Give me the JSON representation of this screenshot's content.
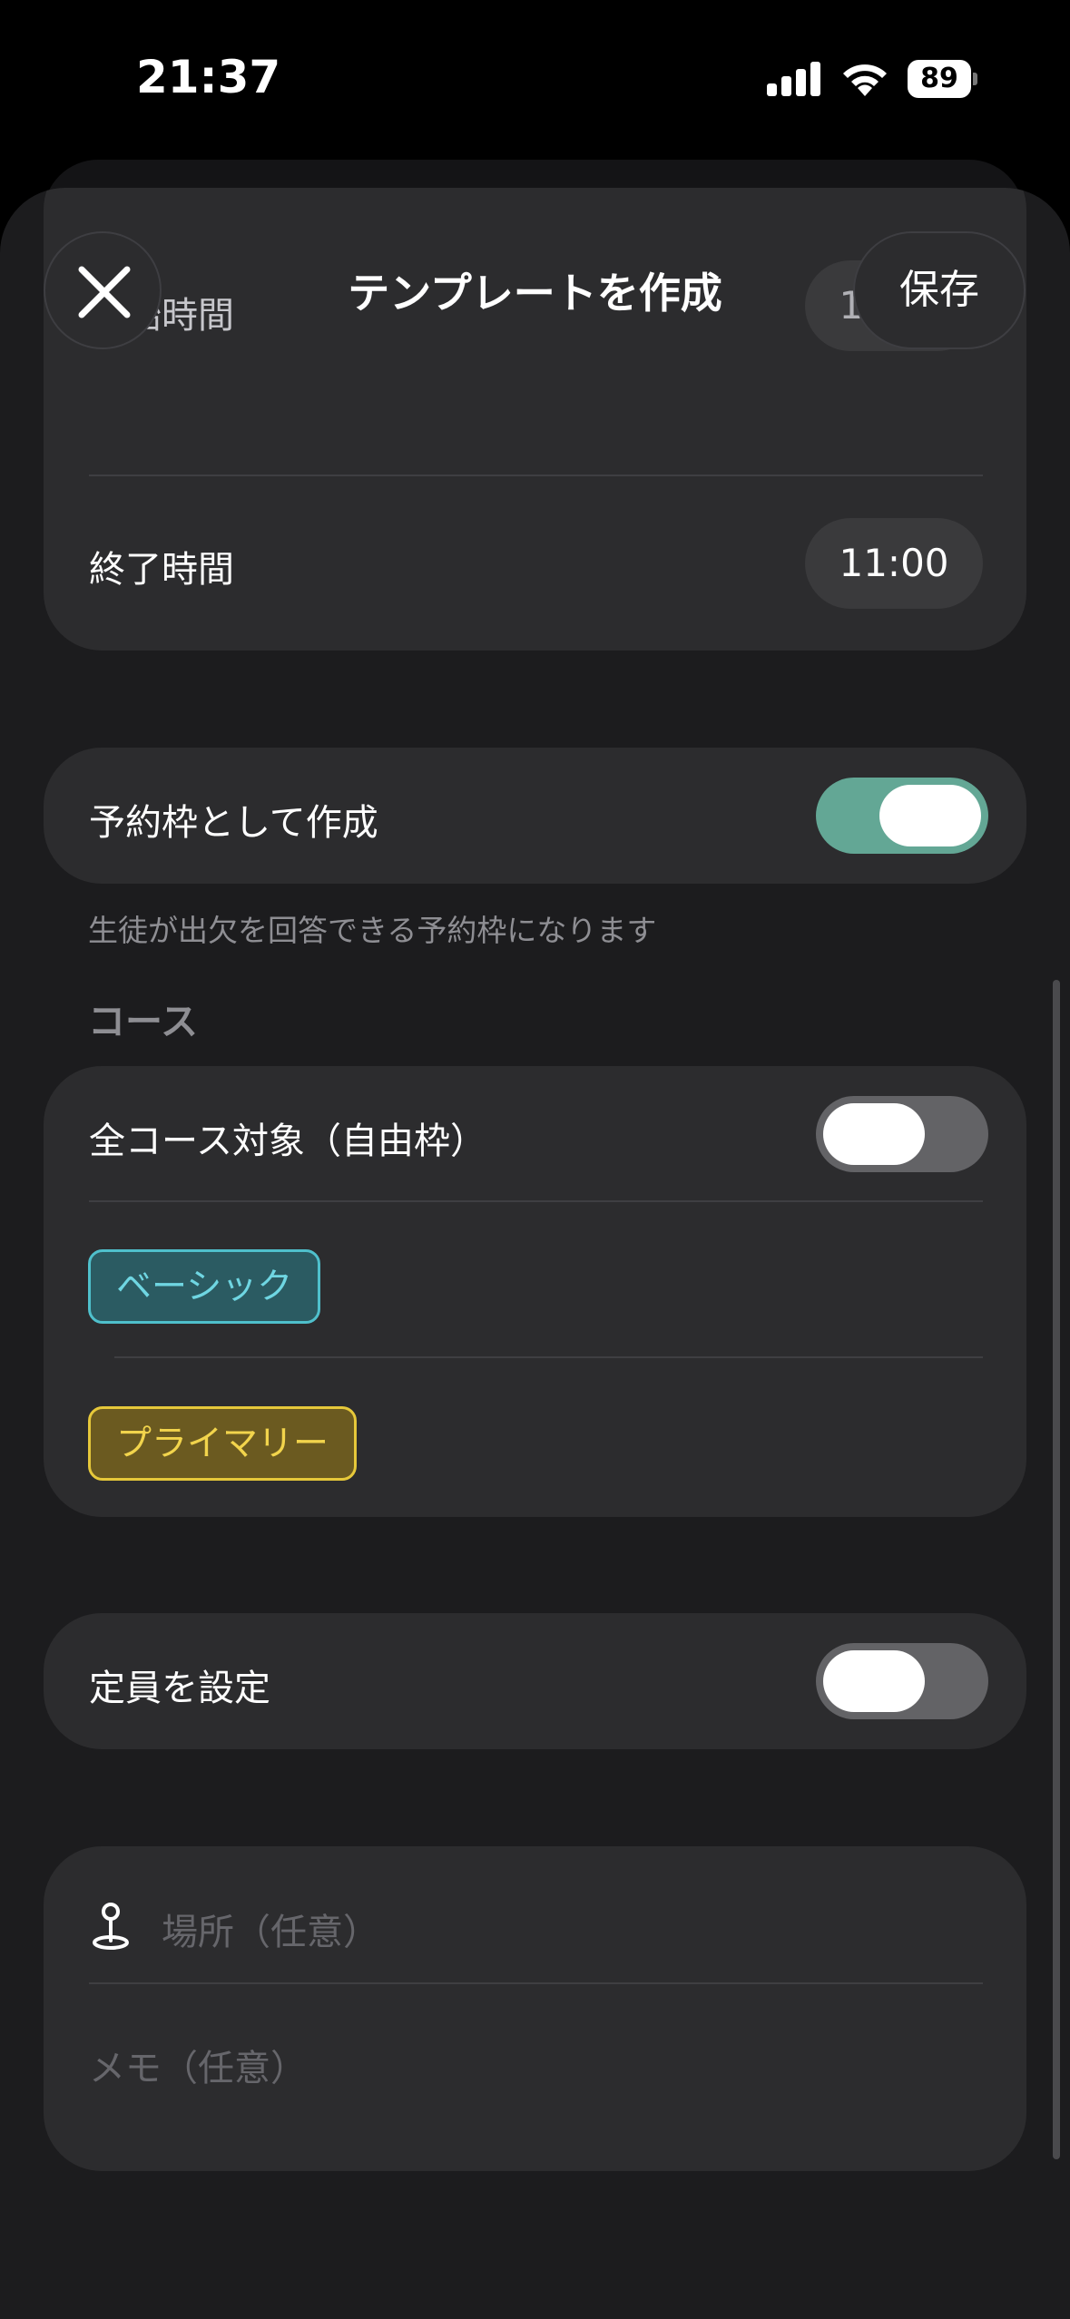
{
  "status_bar": {
    "time": "21:37",
    "battery": "89"
  },
  "header": {
    "title": "テンプレートを作成",
    "save_label": "保存",
    "close_icon": "close-icon"
  },
  "time_section": {
    "start_label": "開始時間",
    "start_value": "10:00",
    "end_label": "終了時間",
    "end_value": "11:00"
  },
  "reservation": {
    "label": "予約枠として作成",
    "enabled": true,
    "caption": "生徒が出欠を回答できる予約枠になります"
  },
  "course": {
    "header": "コース",
    "all_courses_label": "全コース対象（自由枠）",
    "all_courses_enabled": false,
    "tags": [
      {
        "label": "ベーシック",
        "color": "#4fc0cc"
      },
      {
        "label": "プライマリー",
        "color": "#e6c83a"
      }
    ]
  },
  "capacity": {
    "label": "定員を設定",
    "enabled": false
  },
  "details": {
    "location_placeholder": "場所（任意）",
    "memo_placeholder": "メモ（任意）"
  },
  "colors": {
    "toggle_on": "#63a795",
    "background": "#1c1c1e",
    "card": "#2c2c2e"
  }
}
